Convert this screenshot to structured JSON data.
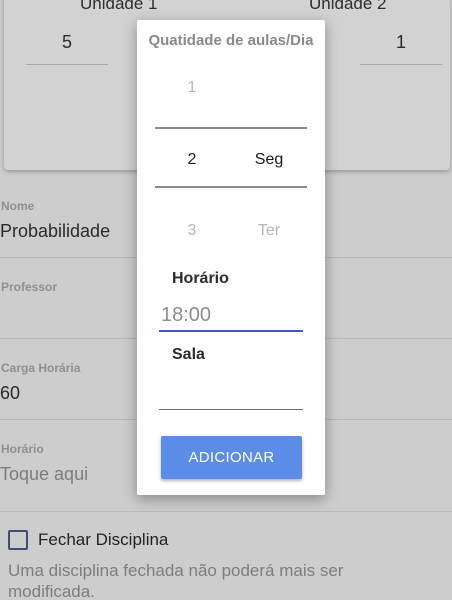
{
  "background": {
    "units": [
      {
        "title": "Unidade 1",
        "value": "5"
      },
      {
        "title": "Unidade 2",
        "value": "1"
      }
    ],
    "fields": {
      "nome": {
        "label": "Nome",
        "value": "Probabilidade"
      },
      "professor": {
        "label": "Professor",
        "value": ""
      },
      "carga": {
        "label": "Carga Horária",
        "value": "60"
      },
      "horario": {
        "label": "Horário",
        "placeholder": "Toque aqui"
      }
    },
    "checkbox": {
      "label": "Fechar Disciplina",
      "checked": false
    },
    "help_text": "Uma disciplina fechada não poderá mais ser modificada."
  },
  "dialog": {
    "title": "Quatidade de aulas/Dia",
    "picker": {
      "numbers": [
        "1",
        "2",
        "3"
      ],
      "selected_number": "2",
      "days": [
        "Seg",
        "Ter"
      ],
      "selected_day": "Seg"
    },
    "horario_label": "Horário",
    "horario_value": "18:00",
    "sala_label": "Sala",
    "sala_value": "",
    "add_button": "ADICIONAR"
  },
  "colors": {
    "accent": "#5b8de6",
    "input_focus": "#3f57c9",
    "scrim": "#cdcdcd"
  }
}
